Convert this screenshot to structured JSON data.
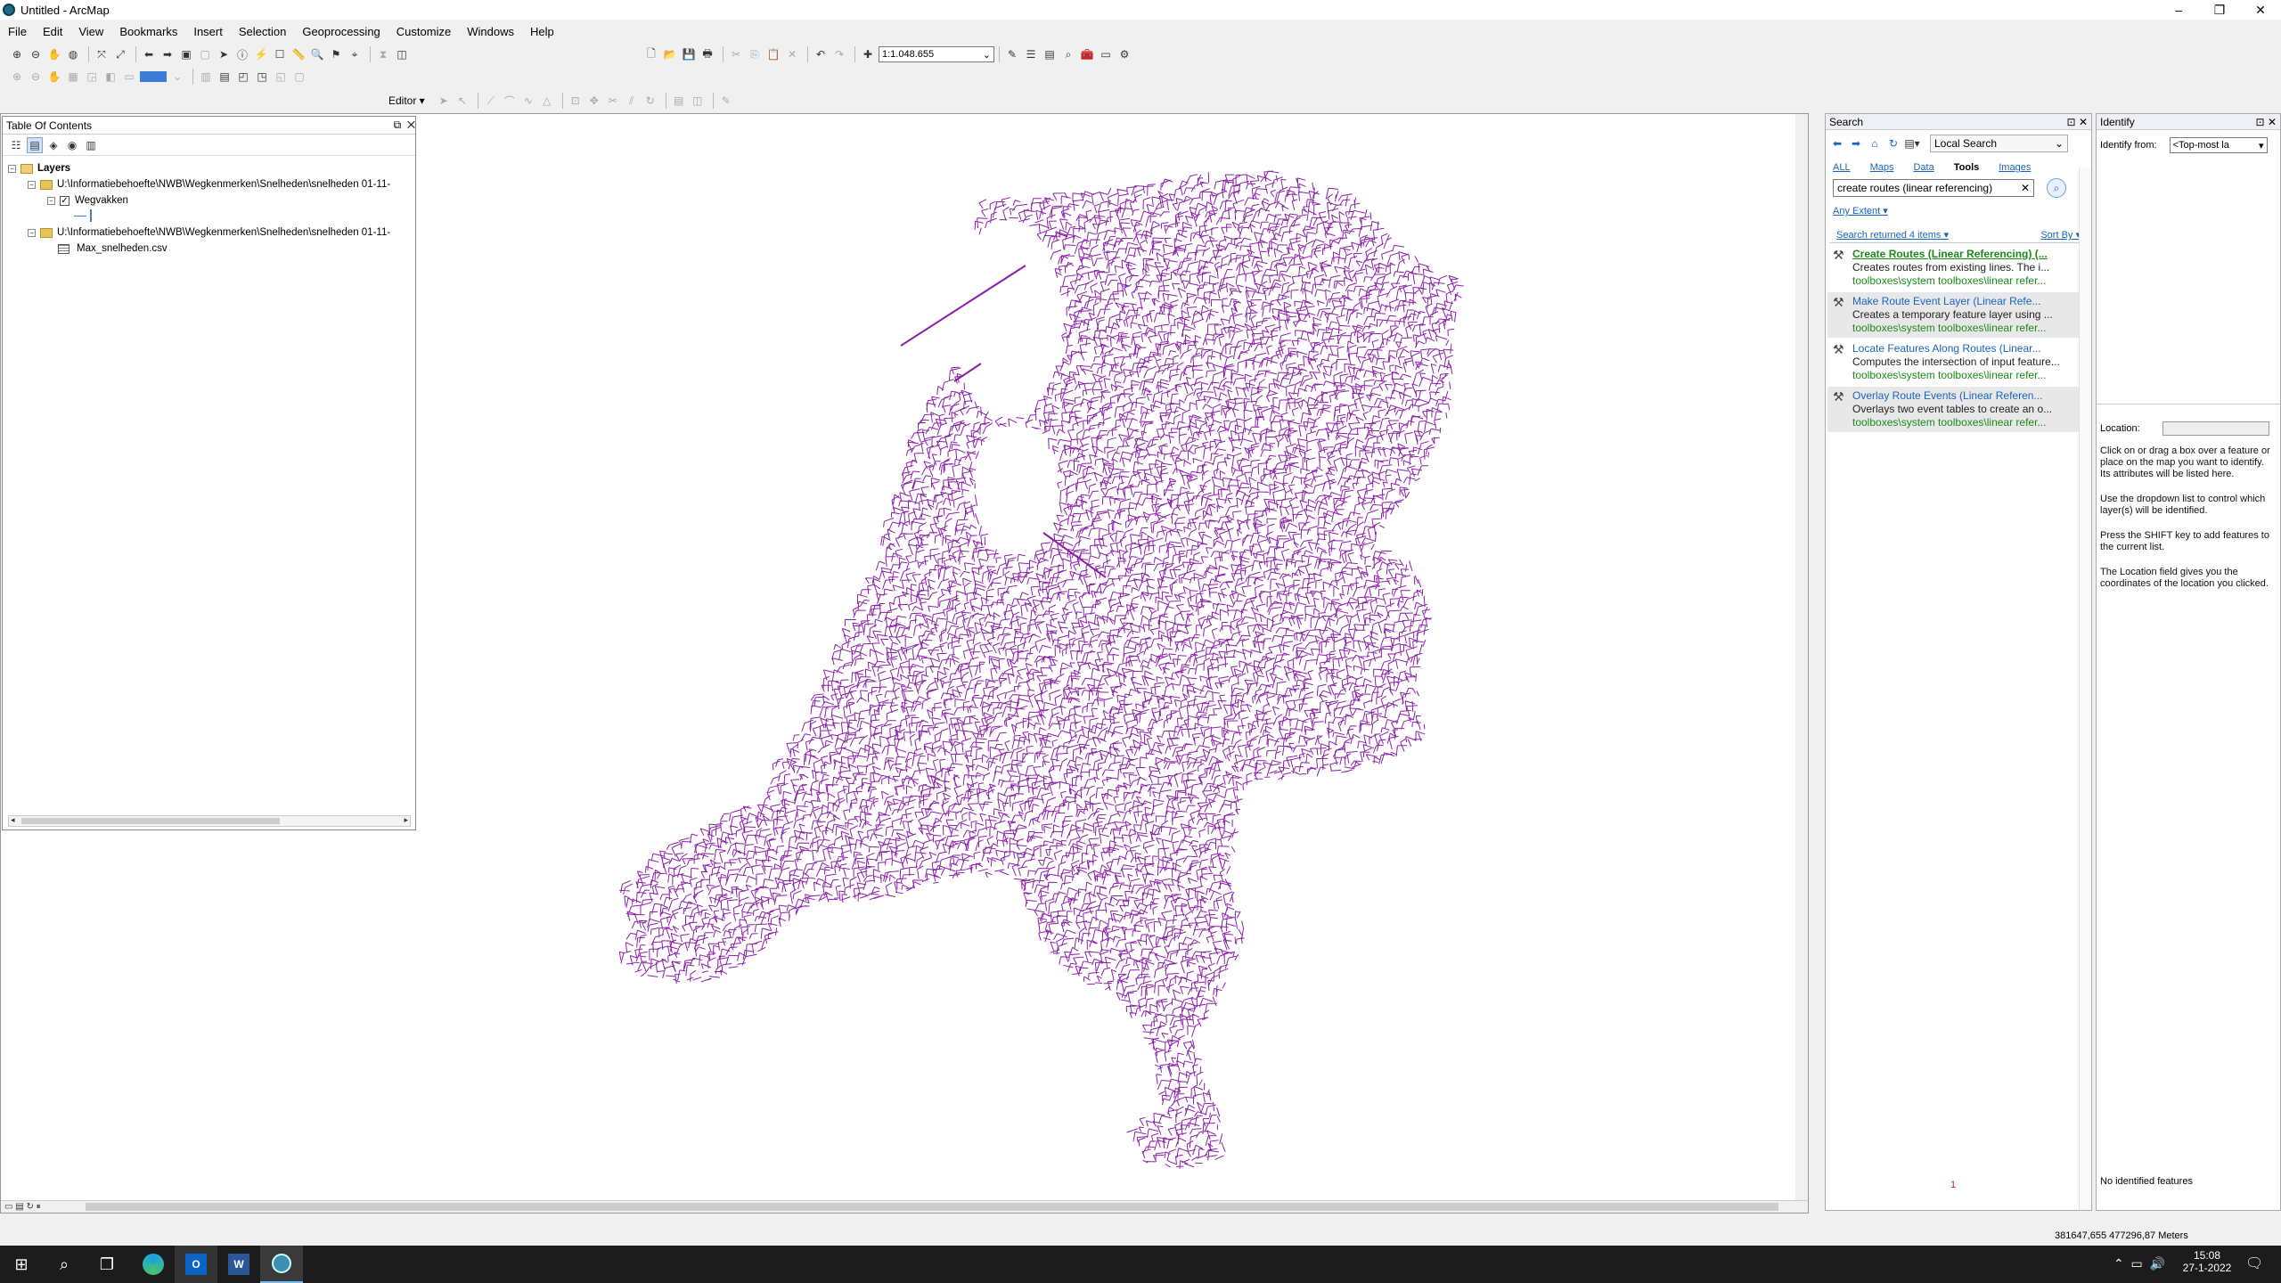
{
  "window": {
    "title": "Untitled - ArcMap",
    "min": "–",
    "restore": "❐",
    "close": "✕"
  },
  "menu": [
    "File",
    "Edit",
    "View",
    "Bookmarks",
    "Insert",
    "Selection",
    "Geoprocessing",
    "Customize",
    "Windows",
    "Help"
  ],
  "toolbar": {
    "scale": "1:1.048.655",
    "editor": "Editor ▾"
  },
  "toc": {
    "title": "Table Of Contents",
    "root": "Layers",
    "path1": "U:\\Informatiebehoefte\\NWB\\Wegkenmerken\\Snelheden\\snelheden 01-11-",
    "layer1": "Wegvakken",
    "path2": "U:\\Informatiebehoefte\\NWB\\Wegkenmerken\\Snelheden\\snelheden 01-11-",
    "table": "Max_snelheden.csv"
  },
  "map": {
    "color": "#8b1fa8"
  },
  "search": {
    "title": "Search",
    "scope": "Local Search",
    "tabs": [
      "ALL",
      "Maps",
      "Data",
      "Tools",
      "Images"
    ],
    "query": "create routes (linear referencing)",
    "extent": "Any Extent ▾",
    "returned": "Search returned 4 items ▾",
    "sort": "Sort By ▾",
    "results": [
      {
        "title": "Create Routes (Linear Referencing) (...",
        "desc": "Creates routes from existing lines. The i...",
        "path": "toolboxes\\system toolboxes\\linear refer..."
      },
      {
        "title": "Make Route Event Layer (Linear Refe...",
        "desc": "Creates a temporary feature layer using ...",
        "path": "toolboxes\\system toolboxes\\linear refer..."
      },
      {
        "title": "Locate Features Along Routes (Linear...",
        "desc": "Computes the intersection of input feature...",
        "path": "toolboxes\\system toolboxes\\linear refer..."
      },
      {
        "title": "Overlay Route Events (Linear Referen...",
        "desc": "Overlays two event tables to create an o...",
        "path": "toolboxes\\system toolboxes\\linear refer..."
      }
    ],
    "footer": "1"
  },
  "identify": {
    "title": "Identify",
    "from_label": "Identify from:",
    "from_value": "<Top-most la",
    "location_label": "Location:",
    "help1": "Click on or drag a box over a feature or place on the map you want to identify. Its attributes will be listed here.",
    "help2": "Use the dropdown list to control which layer(s) will be identified.",
    "help3": "Press the SHIFT key to add features to the current list.",
    "help4": "The Location field gives you the coordinates of the location you clicked.",
    "status": "No identified features"
  },
  "status": {
    "coords": "381647,655  477296,87 Meters"
  },
  "taskbar": {
    "time": "15:08",
    "date": "27-1-2022"
  }
}
